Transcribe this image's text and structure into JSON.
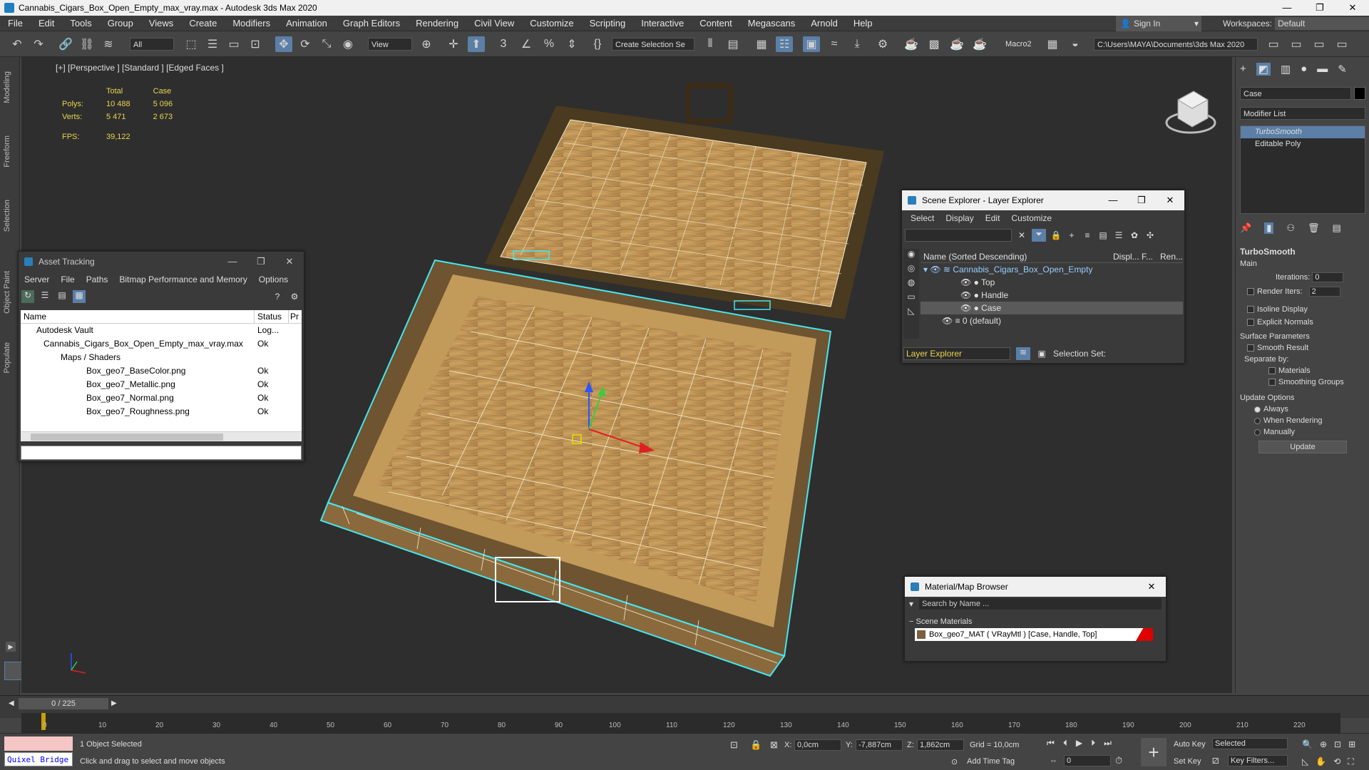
{
  "window": {
    "title": "Cannabis_Cigars_Box_Open_Empty_max_vray.max - Autodesk 3ds Max 2020",
    "min": "—",
    "max": "❐",
    "close": "✕"
  },
  "menu": [
    "File",
    "Edit",
    "Tools",
    "Group",
    "Views",
    "Create",
    "Modifiers",
    "Animation",
    "Graph Editors",
    "Rendering",
    "Civil View",
    "Customize",
    "Scripting",
    "Interactive",
    "Content",
    "Megascans",
    "Arnold",
    "Help"
  ],
  "signin": {
    "label": "Sign In"
  },
  "workspaces": {
    "label": "Workspaces:",
    "value": "Default"
  },
  "toolbar": {
    "filter": "All",
    "ref_coord": "View",
    "selset": "Create Selection Se",
    "macro": "Macro2",
    "path": "C:\\Users\\MAYA\\Documents\\3ds Max 2020"
  },
  "lefttabs": [
    "Modeling",
    "Freeform",
    "Selection",
    "Object Paint",
    "Populate"
  ],
  "viewport": {
    "label": "[+] [Perspective ] [Standard ] [Edged Faces ]",
    "stats": {
      "col_total": "Total",
      "col_case": "Case",
      "polys_label": "Polys:",
      "polys_total": "10 488",
      "polys_case": "5 096",
      "verts_label": "Verts:",
      "verts_total": "5 471",
      "verts_case": "2 673",
      "fps_label": "FPS:",
      "fps_value": "39,122"
    }
  },
  "asset_tracking": {
    "title": "Asset Tracking",
    "menu": [
      "Server",
      "File",
      "Paths",
      "Bitmap Performance and Memory",
      "Options"
    ],
    "col_name": "Name",
    "col_status": "Status",
    "col_pr": "Pr",
    "rows": [
      {
        "name": "Autodesk Vault",
        "status": "Log..."
      },
      {
        "name": "Cannabis_Cigars_Box_Open_Empty_max_vray.max",
        "status": "Ok"
      },
      {
        "name": "Maps / Shaders",
        "status": ""
      },
      {
        "name": "Box_geo7_BaseColor.png",
        "status": "Ok"
      },
      {
        "name": "Box_geo7_Metallic.png",
        "status": "Ok"
      },
      {
        "name": "Box_geo7_Normal.png",
        "status": "Ok"
      },
      {
        "name": "Box_geo7_Roughness.png",
        "status": "Ok"
      }
    ]
  },
  "scene_explorer": {
    "title": "Scene Explorer - Layer Explorer",
    "menu": [
      "Select",
      "Display",
      "Edit",
      "Customize"
    ],
    "col_name": "Name (Sorted Descending)",
    "col_disp": "Displ...",
    "col_f": "F...",
    "col_ren": "Ren...",
    "rows": [
      {
        "name": "Cannabis_Cigars_Box_Open_Empty",
        "indent": 0
      },
      {
        "name": "Top",
        "indent": 1
      },
      {
        "name": "Handle",
        "indent": 1
      },
      {
        "name": "Case",
        "indent": 1
      },
      {
        "name": "0 (default)",
        "indent": 0
      }
    ],
    "footer_layer": "Layer Explorer",
    "footer_selset": "Selection Set:"
  },
  "material_browser": {
    "title": "Material/Map Browser",
    "search": "Search by Name ...",
    "group": "Scene Materials",
    "item": "Box_geo7_MAT  ( VRayMtl )  [Case, Handle, Top]"
  },
  "command_panel": {
    "object_name": "Case",
    "modifier_list": "Modifier List",
    "stack": [
      "TurboSmooth",
      "Editable Poly"
    ],
    "turbosmooth": {
      "title": "TurboSmooth",
      "main": "Main",
      "iterations_label": "Iterations:",
      "iterations": "0",
      "render_iters_label": "Render Iters:",
      "render_iters": "2",
      "isoline": "Isoline Display",
      "explicit": "Explicit Normals",
      "surface": "Surface Parameters",
      "smooth_result": "Smooth Result",
      "separate_by": "Separate by:",
      "materials": "Materials",
      "smoothing_groups": "Smoothing Groups",
      "update_options": "Update Options",
      "always": "Always",
      "when_rendering": "When Rendering",
      "manually": "Manually",
      "update": "Update"
    }
  },
  "timeline": {
    "frame": "0 / 225",
    "ticks": [
      "0",
      "10",
      "20",
      "30",
      "40",
      "50",
      "60",
      "70",
      "80",
      "90",
      "100",
      "110",
      "120",
      "130",
      "140",
      "150",
      "160",
      "170",
      "180",
      "190",
      "200",
      "210",
      "220"
    ]
  },
  "status": {
    "quixel": "Quixel Bridge",
    "selected": "1 Object Selected",
    "hint": "Click and drag to select and move objects",
    "x_label": "X:",
    "x": "0,0cm",
    "y_label": "Y:",
    "y": "-7,887cm",
    "z_label": "Z:",
    "z": "1,862cm",
    "grid": "Grid = 10,0cm",
    "add_time_tag": "Add Time Tag",
    "auto_key": "Auto Key",
    "set_key": "Set Key",
    "selected_dd": "Selected",
    "key_filters": "Key Filters...",
    "frame_field": "0"
  },
  "colors": {
    "accent": "#5b7fa6",
    "selection": "#46e6f0",
    "stats": "#e8d44f"
  }
}
